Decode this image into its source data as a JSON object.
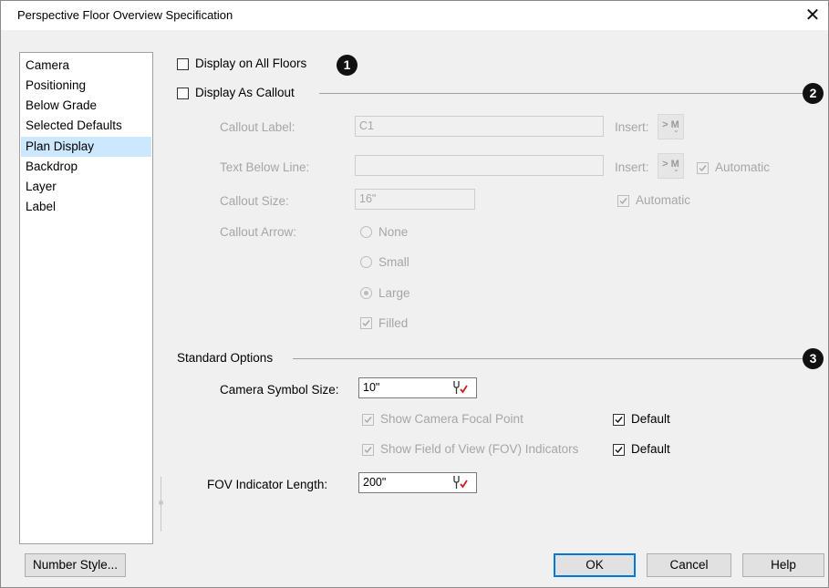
{
  "window": {
    "title": "Perspective Floor Overview Specification",
    "close_glyph": "✕"
  },
  "nav": {
    "items": [
      {
        "label": "Camera"
      },
      {
        "label": "Positioning"
      },
      {
        "label": "Below Grade"
      },
      {
        "label": "Selected Defaults"
      },
      {
        "label": "Plan Display",
        "selected": true
      },
      {
        "label": "Backdrop"
      },
      {
        "label": "Layer"
      },
      {
        "label": "Label"
      }
    ]
  },
  "badges": [
    "1",
    "2",
    "3"
  ],
  "display_all_floors": {
    "label": "Display on All Floors",
    "checked": false
  },
  "display_callout": {
    "label": "Display As Callout",
    "checked": false,
    "callout_label": {
      "label": "Callout Label:",
      "value": "C1",
      "insert_label": "Insert:",
      "insert_btn": "> M"
    },
    "text_below": {
      "label": "Text Below Line:",
      "value": "",
      "insert_label": "Insert:",
      "insert_btn": "> M",
      "automatic_label": "Automatic",
      "automatic_checked": true
    },
    "callout_size": {
      "label": "Callout Size:",
      "value": "16\"",
      "automatic_label": "Automatic",
      "automatic_checked": true
    },
    "callout_arrow": {
      "label": "Callout Arrow:",
      "options": [
        {
          "label": "None",
          "selected": false
        },
        {
          "label": "Small",
          "selected": false
        },
        {
          "label": "Large",
          "selected": true
        }
      ],
      "filled_label": "Filled",
      "filled_checked": true
    }
  },
  "standard_options": {
    "heading": "Standard Options",
    "camera_symbol_size": {
      "label": "Camera Symbol Size:",
      "value": "10\""
    },
    "show_focal": {
      "label": "Show Camera Focal Point",
      "checked": true,
      "default_label": "Default",
      "default_checked": true
    },
    "show_fov": {
      "label": "Show Field of View (FOV) Indicators",
      "checked": true,
      "default_label": "Default",
      "default_checked": true
    },
    "fov_length": {
      "label": "FOV Indicator Length:",
      "value": "200\""
    }
  },
  "buttons": {
    "number_style": "Number Style...",
    "ok": "OK",
    "cancel": "Cancel",
    "help": "Help"
  },
  "colors": {
    "accent": "#0078d7",
    "selection": "#cce8ff",
    "wrench_red": "#d0201a"
  }
}
